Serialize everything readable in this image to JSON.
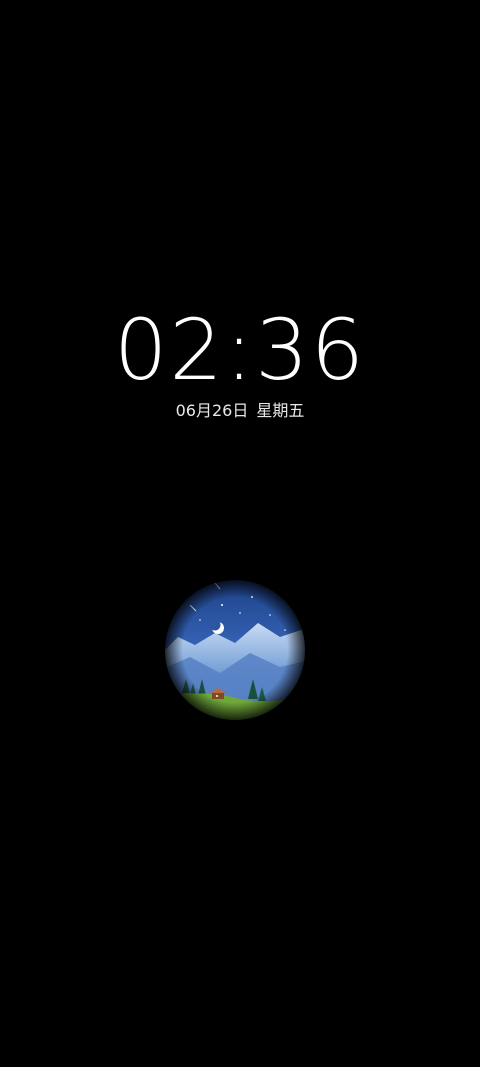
{
  "lock_screen": {
    "time": "02:36",
    "date": "06月26日",
    "weekday": "星期五"
  },
  "scene": {
    "sky_color": "#2f5fae",
    "mountain_color": "#7aa3d8",
    "grass_color": "#6fa83a",
    "moon_icon": "crescent-moon-icon"
  }
}
